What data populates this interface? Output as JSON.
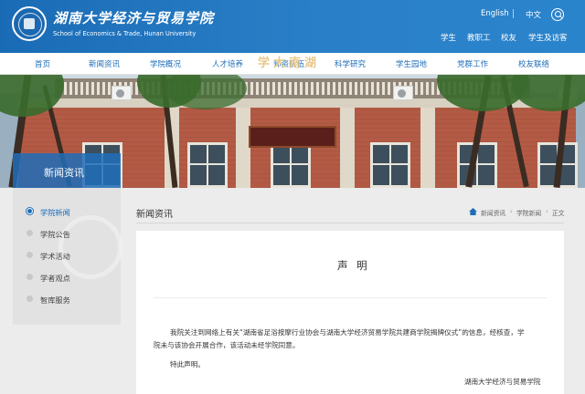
{
  "header": {
    "brand_cn": "湖南大学经济与贸易学院",
    "brand_en": "School of Economics & Trade, Hunan University",
    "lang_links": [
      "English",
      "中文"
    ],
    "quick_links": [
      "学生",
      "教职工",
      "校友",
      "学生及访客"
    ]
  },
  "nav": [
    "首页",
    "新闻资讯",
    "学院概况",
    "人才培养",
    "师资队伍",
    "科学研究",
    "学生园地",
    "党群工作",
    "校友联络"
  ],
  "banner": {
    "title": "新闻资讯",
    "plaque": "学大南湖"
  },
  "sidebar": {
    "items": [
      {
        "label": "学院新闻",
        "active": true
      },
      {
        "label": "学院公告",
        "active": false
      },
      {
        "label": "学术活动",
        "active": false
      },
      {
        "label": "学者观点",
        "active": false
      },
      {
        "label": "智库服务",
        "active": false
      }
    ]
  },
  "main": {
    "title": "新闻资讯",
    "breadcrumb": [
      "新闻资讯",
      "学院新闻",
      "正文"
    ]
  },
  "article": {
    "title": "声 明",
    "para1_line1": "我院关注到网络上有关“湖南省足浴按摩行业协会与湖南大学经济贸易学院共建商学院揭牌仪式”的信息，经核查，学",
    "para1_line2": "院未与该协会开展合作，该活动未经学院同意。",
    "para2": "特此声明。",
    "signature": "湖南大学经济与贸易学院"
  },
  "colors": {
    "primary": "#1e6db8",
    "header_bg": "#2a80c8",
    "page_bg": "#ececec"
  }
}
